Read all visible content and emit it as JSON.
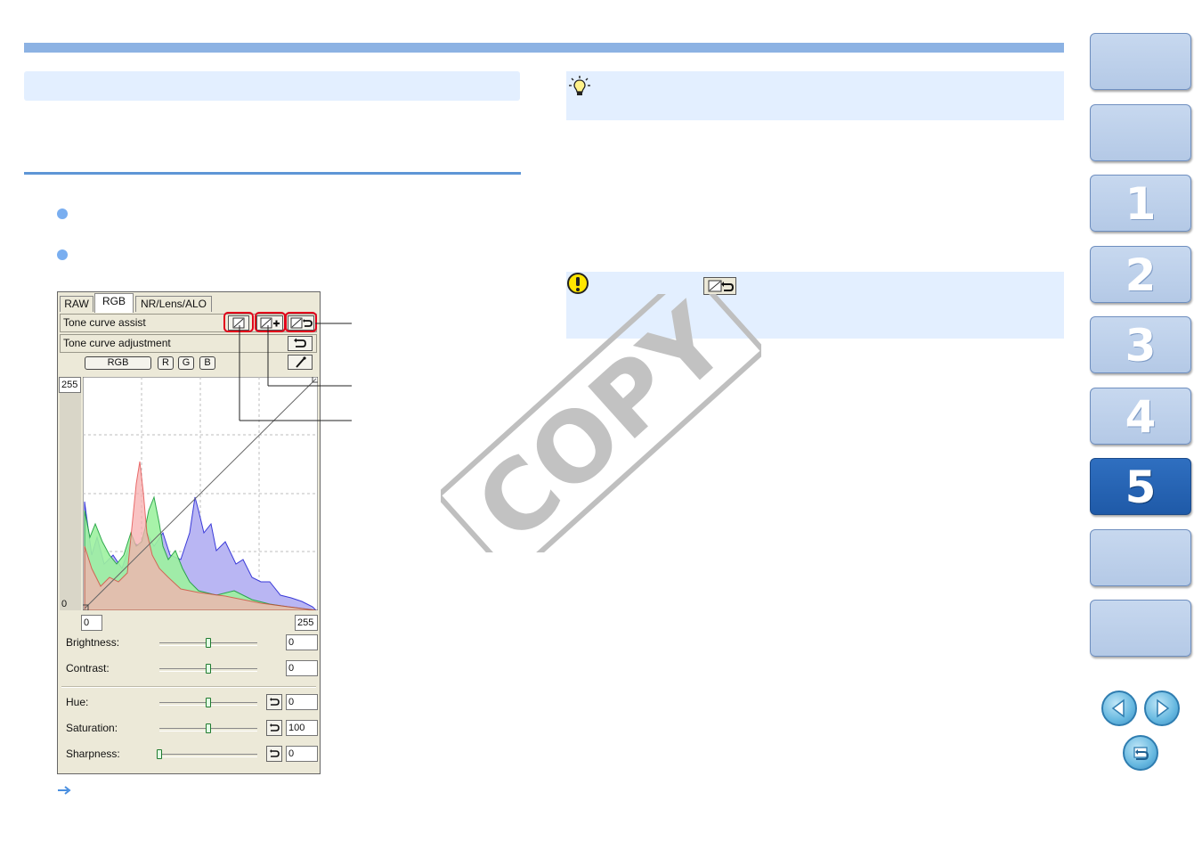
{
  "side_tabs": [
    {
      "label": "",
      "active": false
    },
    {
      "label": "",
      "active": false
    },
    {
      "label": "1",
      "active": false
    },
    {
      "label": "2",
      "active": false
    },
    {
      "label": "3",
      "active": false
    },
    {
      "label": "4",
      "active": false
    },
    {
      "label": "5",
      "active": true
    },
    {
      "label": "",
      "active": false
    },
    {
      "label": "",
      "active": false
    }
  ],
  "watermark": "COPY",
  "palette": {
    "tabs": [
      "RAW",
      "RGB",
      "NR/Lens/ALO"
    ],
    "selected_tab": "RGB",
    "tone_curve_assist_label": "Tone curve assist",
    "tone_curve_adjustment_label": "Tone curve adjustment",
    "channel_buttons": [
      "RGB",
      "R",
      "G",
      "B"
    ],
    "graph_y_max": "255",
    "graph_y_min": "0",
    "input_low": "0",
    "input_high": "255",
    "sliders": [
      {
        "label": "Brightness:",
        "value": "0",
        "level": 0.5,
        "reset": false
      },
      {
        "label": "Contrast:",
        "value": "0",
        "level": 0.5,
        "reset": false
      },
      {
        "label": "Hue:",
        "value": "0",
        "level": 0.5,
        "reset": true
      },
      {
        "label": "Saturation:",
        "value": "100",
        "level": 0.5,
        "reset": true
      },
      {
        "label": "Sharpness:",
        "value": "0",
        "level": 0.0,
        "reset": true
      }
    ]
  },
  "colors": {
    "accent_bar": "#8cb2e3",
    "panel_bg": "#e3efff",
    "side_tab_active": "#2466b5",
    "highlight_ring": "#e2001a"
  },
  "icons": [
    "tip-lightbulb-icon",
    "caution-icon",
    "arrow-right-icon",
    "prev-page-icon",
    "next-page-icon",
    "return-icon"
  ]
}
